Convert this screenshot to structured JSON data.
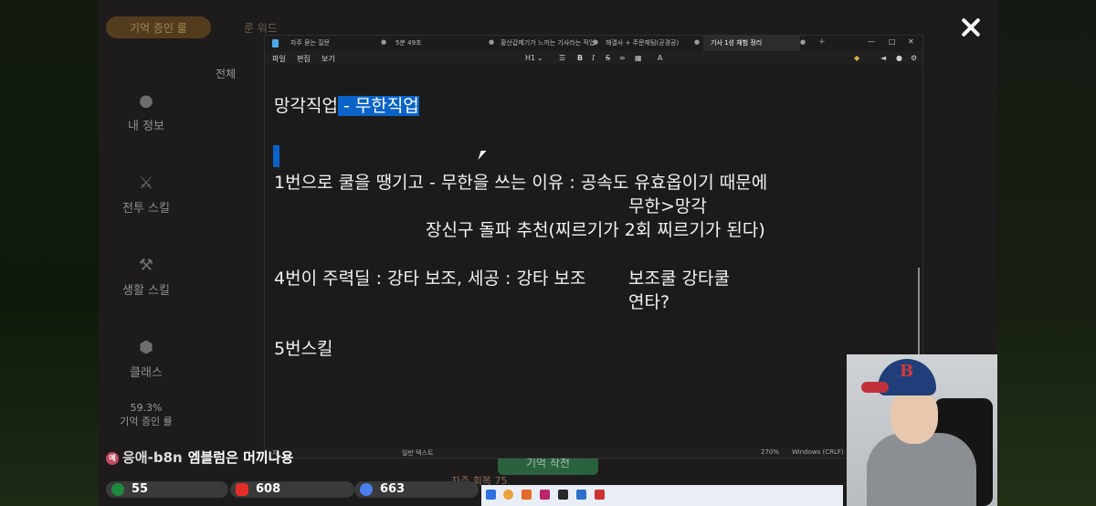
{
  "game": {
    "tabs": [
      "기억 증인 룰",
      "룬 워드"
    ],
    "filter_all": "전체",
    "nav": [
      {
        "label": "내 정보",
        "icon": "person-icon"
      },
      {
        "label": "전투 스킬",
        "icon": "sword-icon"
      },
      {
        "label": "생활 스킬",
        "icon": "axe-icon"
      },
      {
        "label": "클래스",
        "icon": "hexagon-icon"
      }
    ],
    "progress": "59.3%",
    "progress_caption": "기억 증인 률",
    "green_button": "기억 작전",
    "footer": "자주 회복 75"
  },
  "notepad": {
    "tabs": [
      "자주 묻는 질문",
      "5분 49초",
      "황산갑메기가 느끼는 기사라는 직업",
      "해결사 + 주문제팀(공경공)",
      "기사 1성 체험 정리"
    ],
    "active_tab_index": 4,
    "menu": [
      "파일",
      "편집",
      "보기"
    ],
    "toolbar": {
      "heading": "H1",
      "bold": "B",
      "italic": "I",
      "strike": "S",
      "marker": "A"
    },
    "content": {
      "line1_plain": "망각직업",
      "line1_selected": " - 무한직업",
      "line2": "1번으로 쿨을 땡기고 - 무한을 쓰는 이유 : 공속도 유효옵이기 때문에",
      "line3": "무한>망각",
      "line4": "장신구 돌파 추천(찌르기가 2회 찌르기가 된다)",
      "line5a": "4번이 주력딜 : 강타 보조, 세공 : 강타 보조",
      "line5b": "보조쿨 강타쿨",
      "line6": "연타?",
      "line7": "5번스킬"
    },
    "status": {
      "text_type": "일반 텍스트",
      "zoom": "270%",
      "line_ending": "Windows (CRLF)",
      "chars": "자"
    }
  },
  "chat": {
    "badge": "예",
    "user": "응애-b8n",
    "message": "엠블럼은 머끼나용"
  },
  "counters": [
    {
      "value": "55",
      "color": "#1e8a3e",
      "icon": "chzzk-icon"
    },
    {
      "value": "608",
      "color": "#e52d27",
      "icon": "youtube-icon"
    },
    {
      "value": "663",
      "color": "#4a7ff0",
      "icon": "wave-icon"
    }
  ],
  "colors": {
    "selection": "#0b63c9",
    "editor_bg": "#1b1b1b"
  }
}
